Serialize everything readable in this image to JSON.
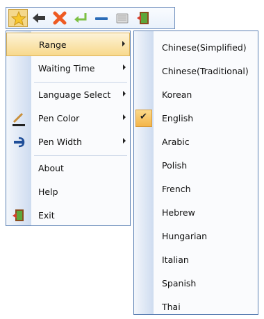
{
  "toolbar": {
    "buttons": [
      {
        "icon": "star-icon"
      },
      {
        "icon": "back-arrow-icon"
      },
      {
        "icon": "close-icon"
      },
      {
        "icon": "enter-icon"
      },
      {
        "icon": "minimize-icon"
      },
      {
        "icon": "keyboard-icon"
      },
      {
        "icon": "exit-door-icon"
      }
    ]
  },
  "menu": {
    "items": [
      {
        "label": "Range"
      },
      {
        "label": "Waiting Time"
      },
      {
        "label": "Language Select"
      },
      {
        "label": "Pen Color"
      },
      {
        "label": "Pen Width"
      },
      {
        "label": "About"
      },
      {
        "label": "Help"
      },
      {
        "label": "Exit"
      }
    ]
  },
  "submenu": {
    "items": [
      {
        "label": "Chinese(Simplified)"
      },
      {
        "label": "Chinese(Traditional)"
      },
      {
        "label": "Korean"
      },
      {
        "label": "English"
      },
      {
        "label": "Arabic"
      },
      {
        "label": "Polish"
      },
      {
        "label": "French"
      },
      {
        "label": "Hebrew"
      },
      {
        "label": "Hungarian"
      },
      {
        "label": "Italian"
      },
      {
        "label": "Spanish"
      },
      {
        "label": "Thai"
      }
    ],
    "checked": "English",
    "check_glyph": "✔"
  },
  "colors": {
    "highlight": "#f8d98c",
    "border": "#5a7fb3",
    "gutter": "#cedcf0"
  }
}
